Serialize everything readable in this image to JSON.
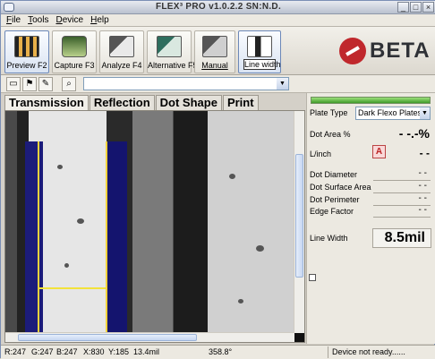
{
  "window": {
    "title": "FLEX³ PRO v1.0.2.2 SN:N.D."
  },
  "menu": [
    "File",
    "Tools",
    "Device",
    "Help"
  ],
  "toolbar": {
    "buttons": [
      {
        "label": "Preview F2",
        "icon": "film-strip-icon"
      },
      {
        "label": "Capture F3",
        "icon": "camera-icon"
      },
      {
        "label": "Analyze F4",
        "icon": "calculator-icon"
      },
      {
        "label": "Alternative F5",
        "icon": "alternative-calculator-icon"
      },
      {
        "label": "Manual",
        "icon": "manual-measure-icon"
      },
      {
        "label": "Line width",
        "icon": "line-width-icon"
      }
    ],
    "logo_text": "BETA"
  },
  "tabs": [
    "Transmission",
    "Reflection",
    "Dot Shape",
    "Print"
  ],
  "panel": {
    "plate_type_label": "Plate Type",
    "plate_type_value": "Dark Flexo Plates",
    "dot_area_label": "Dot Area %",
    "dot_area_value": "- -.-%",
    "linch_label": "L/inch",
    "linch_button": "A",
    "linch_value": "- -",
    "dot_diameter_label": "Dot Diameter",
    "dot_diameter_value": "- -",
    "dot_surface_label": "Dot Surface Area",
    "dot_surface_value": "- -",
    "dot_perimeter_label": "Dot Perimeter",
    "dot_perimeter_value": "- -",
    "edge_factor_label": "Edge Factor",
    "edge_factor_value": "- -",
    "line_width_label": "Line Width",
    "line_width_value": "8.5mil"
  },
  "status": {
    "r": "R:247",
    "g": "G:247",
    "b": "B:247",
    "x": "X:830",
    "y": "Y:185",
    "mil": "13.4mil",
    "angle": "358.8°",
    "device": "Device not ready......"
  },
  "colors": {
    "accent_green": "#3f9b2a",
    "logo_red": "#c0282d",
    "band_blue": "#1c1c7a",
    "measure_yellow": "#f2e23a"
  }
}
